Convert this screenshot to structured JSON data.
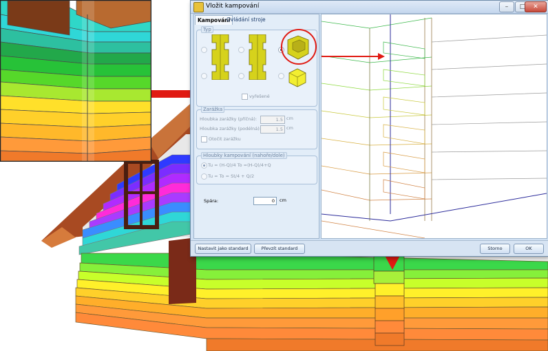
{
  "window": {
    "title": "Vložit kampování",
    "controls": {
      "minimize": "–",
      "maximize": "□",
      "close": "✕"
    }
  },
  "tabs": [
    {
      "label": "Kampování",
      "active": true
    },
    {
      "label": "Ovládání stroje",
      "active": false
    }
  ],
  "typ_group": {
    "label": "Typ",
    "selected_option": 3,
    "checkbox_label": "vyřešené"
  },
  "zarazka_group": {
    "label": "Zarážka",
    "fields": [
      {
        "label": "Hloubka zarážky (příčná):",
        "value": "1.5",
        "unit": "cm"
      },
      {
        "label": "Hloubka zarážky (podélná):",
        "value": "1.5",
        "unit": "cm"
      }
    ],
    "checkbox_label": "Otočit zarážku"
  },
  "hloubky_group": {
    "label": "Hloubky kampování (nahoře/dole)",
    "options": [
      "Tu = (H-Q)/4 To =(H-Q)/4+Q",
      "Tu = To = St/4 + Q/2"
    ]
  },
  "spara": {
    "label": "Spára:",
    "value": "0",
    "unit": "cm"
  },
  "footer": {
    "set_standard": "Nastavit jako standard",
    "take_standard": "Převzít standard",
    "cancel": "Storno",
    "ok": "OK"
  },
  "colors": {
    "annotation_red": "#e01a12",
    "log_yellow": "#d6d21c",
    "dialog_bg": "#cfe0f3"
  }
}
